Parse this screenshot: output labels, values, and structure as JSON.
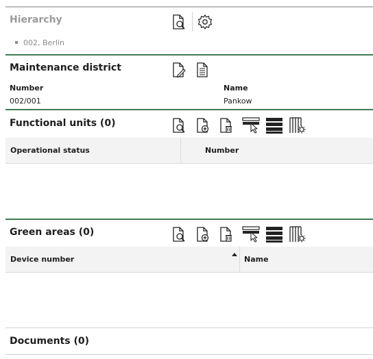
{
  "hierarchy": {
    "title": "Hierarchy",
    "items": [
      {
        "label": "002, Berlin"
      }
    ]
  },
  "maintenance": {
    "title": "Maintenance district",
    "fields": [
      {
        "label": "Number",
        "value": "002/001"
      },
      {
        "label": "Name",
        "value": "Pankow"
      }
    ]
  },
  "functional_units": {
    "title": "Functional units (0)",
    "columns": [
      "Operational status",
      "Number"
    ]
  },
  "green_areas": {
    "title": "Green areas (0)",
    "columns": [
      "Device number",
      "Name"
    ]
  },
  "documents": {
    "title": "Documents (0)"
  },
  "colors": {
    "accent_green": "#3f7a52",
    "muted_title": "#9a9a9a",
    "header_bg": "#f3f3f3"
  },
  "icons": [
    "search-document-icon",
    "settings-gear-icon",
    "edit-document-icon",
    "document-icon",
    "add-document-icon",
    "delete-document-icon",
    "select-rows-icon",
    "list-view-icon",
    "column-settings-icon",
    "sort-ascending-icon"
  ]
}
